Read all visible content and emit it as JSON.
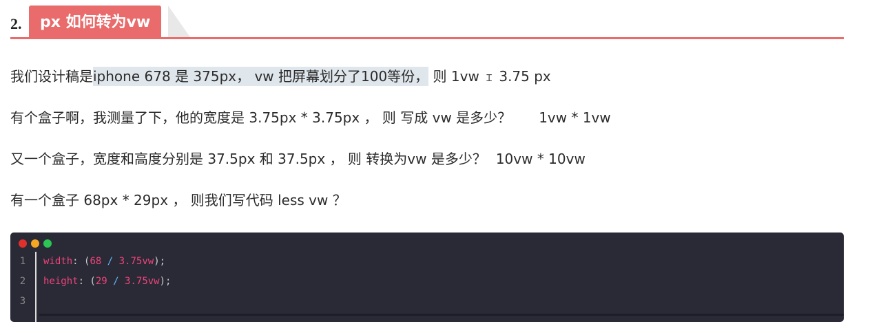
{
  "heading": {
    "number": "2.",
    "title": "px 如何转为vw"
  },
  "paragraphs": {
    "p1": {
      "a": "我们设计稿是",
      "hl": "iphone 678  是  375px，  vw 把屏幕划分了100等份，",
      "b": " 则 1vw ",
      "c": " 3.75 px",
      "cursor": "Ɪ"
    },
    "p2": {
      "text": "有个盒子啊，我测量了下，他的宽度是 3.75px * 3.75px ， 则 写成 vw 是多少？",
      "answer": "1vw * 1vw"
    },
    "p3": {
      "text": "又一个盒子，宽度和高度分别是  37.5px 和 37.5px  ，  则 转换为vw 是多少？",
      "answer": "10vw * 10vw"
    },
    "p4": {
      "text": "有一个盒子  68px  *  29px ，  则我们写代码 less  vw  ？"
    }
  },
  "code": {
    "line_numbers": [
      "1",
      "2",
      "3"
    ],
    "line1": {
      "prop": "width",
      "colon": ": (",
      "n1": "68",
      "op": " / ",
      "n2": "3.75vw",
      "end": ");"
    },
    "line2": {
      "prop": "height",
      "colon": ": (",
      "n1": "29",
      "op": " / ",
      "n2": "3.75vw",
      "end": ");"
    }
  },
  "colors": {
    "accent": "#e96b6b",
    "code_bg": "#292a36",
    "dot_red": "#e0302c",
    "dot_yellow": "#f5a623",
    "dot_green": "#2bc653"
  }
}
